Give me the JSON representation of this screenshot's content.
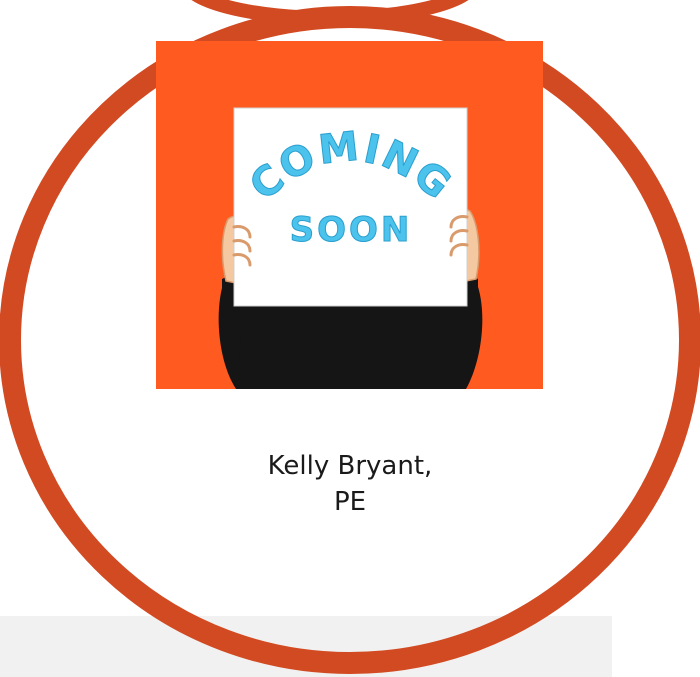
{
  "team_member": {
    "name_line_1": "Kelly Bryant,",
    "name_line_2": "PE"
  },
  "image": {
    "sign_line_1": "COMING",
    "sign_line_2": "SOON",
    "background_color": "#ff5a1f",
    "sign_text_color": "#4cc3ec"
  },
  "colors": {
    "ring": "#d24a22",
    "page_background": "#ffffff",
    "footer_band": "#f1f1f1"
  }
}
